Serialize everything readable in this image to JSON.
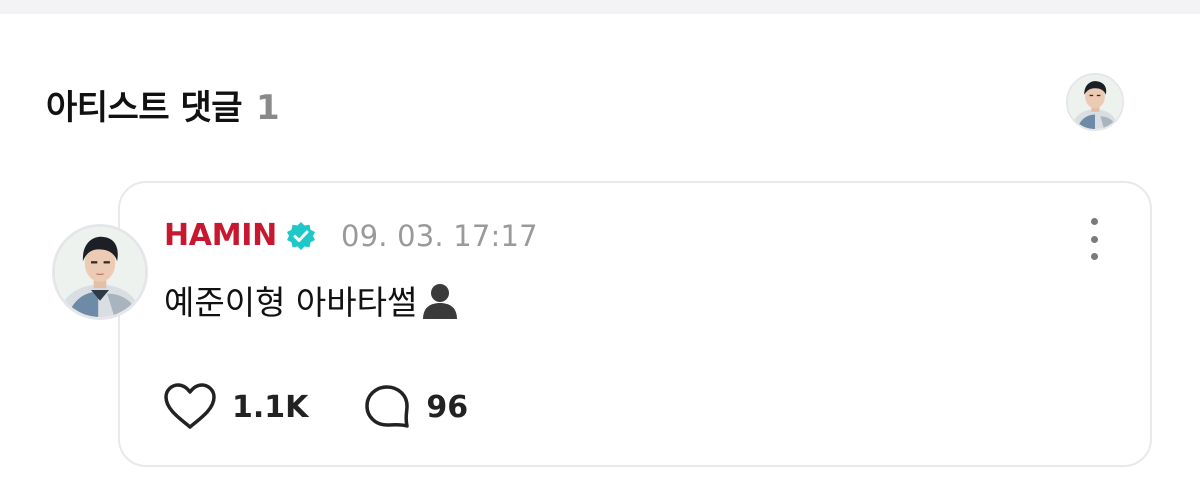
{
  "section": {
    "title": "아티스트 댓글",
    "count": "1"
  },
  "comment": {
    "author": "HAMIN",
    "timestamp": "09. 03. 17:17",
    "text": "예준이형 아바타썰",
    "trailing_icon": "bust-in-silhouette-icon",
    "likes": "1.1K",
    "replies": "96"
  },
  "colors": {
    "author": "#c7182f",
    "verified": "#1ec8c8",
    "timestamp": "#9a9a9a",
    "card_border": "#e8e9ec"
  },
  "icons": {
    "verified": "verified-badge-icon",
    "more": "more-vertical-icon",
    "like": "heart-outline-icon",
    "reply": "speech-bubble-icon"
  }
}
